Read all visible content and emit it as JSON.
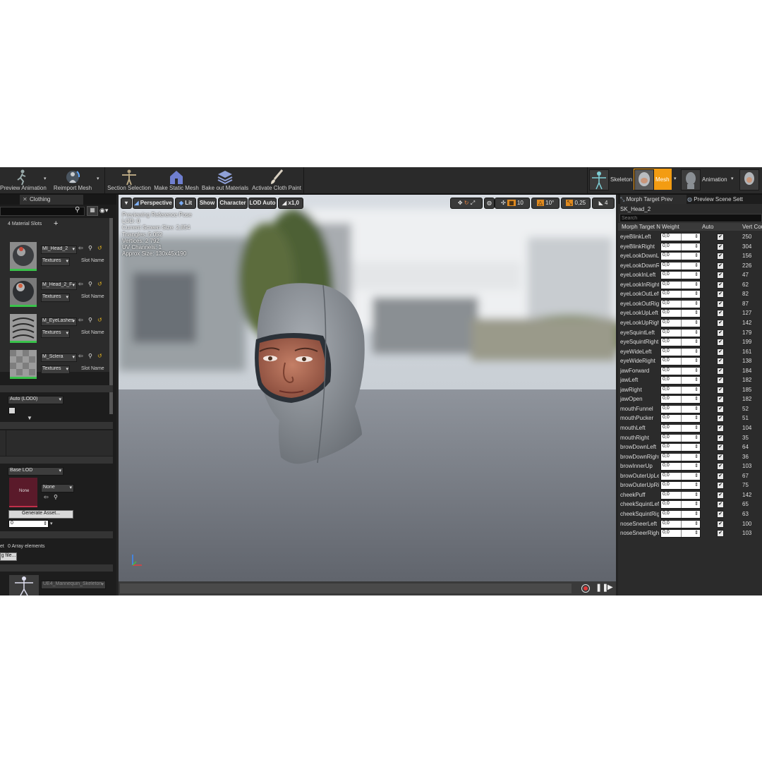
{
  "toolbar": {
    "left_buttons": [
      {
        "label": "Preview Animation",
        "icon": "running-mannequin-icon"
      },
      {
        "label": "Reimport Mesh",
        "icon": "reimport-icon"
      },
      {
        "label": "Section Selection",
        "icon": "t-pose-mannequin-icon"
      },
      {
        "label": "Make Static Mesh",
        "icon": "house-icon"
      },
      {
        "label": "Bake out Materials",
        "icon": "stack-layers-icon"
      },
      {
        "label": "Activate Cloth Paint",
        "icon": "paint-brush-icon"
      }
    ],
    "modes": [
      {
        "label": "Skeleton",
        "icon": "skeleton-mode-icon",
        "active": false
      },
      {
        "label": "Mesh",
        "icon": "mesh-mode-icon",
        "active": true
      },
      {
        "label": "Animation",
        "icon": "animation-mode-icon",
        "active": false
      }
    ],
    "active_color": "#f39c12"
  },
  "left_panel": {
    "tab": "Clothing",
    "material_slots_label": "4 Material Slots",
    "materials": [
      {
        "name": "MI_Head_2",
        "textures": "Textures",
        "slot_label": "Slot Name",
        "thumb": "head-material-thumbnail"
      },
      {
        "name": "M_Head_2_F",
        "textures": "Textures",
        "slot_label": "Slot Name",
        "thumb": "face-material-thumbnail"
      },
      {
        "name": "M_EyeLashes",
        "textures": "Textures",
        "slot_label": "Slot Name",
        "thumb": "eyelashes-material-thumbnail"
      },
      {
        "name": "M_Sclera",
        "textures": "Textures",
        "slot_label": "Slot Name",
        "thumb": "sclera-material-thumbnail"
      }
    ],
    "lod_combo": "Auto (LOD0)",
    "base_lod_combo": "Base LOD",
    "none_thumb": "None",
    "none_combo": "None",
    "generate_asset": "Generate Asset...",
    "numeric_value": "0",
    "array_label": "et",
    "array_elements": "0 Array elements",
    "file_button": "g file...",
    "skeleton_combo": "UE4_Mannequin_Skeleton"
  },
  "viewport": {
    "buttons": {
      "menu": "▾",
      "perspective": "Perspective",
      "lit": "Lit",
      "show": "Show",
      "character": "Character",
      "lod": "LOD Auto",
      "speed": "x1,0",
      "grid_snap": "10",
      "rot_snap": "10°",
      "scale_snap": "0,25",
      "camera_speed": "4"
    },
    "info_lines": [
      "Previewing Reference Pose",
      "LOD: 0",
      "Current Screen Size: 2,854",
      "Triangles: 5 052",
      "Vertices: 2 792",
      "UV Channels: 1",
      "Approx Size: 130x45x190"
    ]
  },
  "right_panel": {
    "tabs": [
      "Morph Target Prev",
      "Preview Scene Sett"
    ],
    "asset_name": "SK_Head_2",
    "search_placeholder": "Search",
    "columns": {
      "name": "Morph Target N",
      "weight": "Weight",
      "auto": "Auto",
      "vert": "Vert Cou"
    },
    "morph_targets": [
      {
        "name": "eyeBlinkLeft",
        "weight": "0,0",
        "auto": true,
        "verts": "250"
      },
      {
        "name": "eyeBlinkRight",
        "weight": "0,0",
        "auto": true,
        "verts": "304"
      },
      {
        "name": "eyeLookDownLeft",
        "weight": "0,0",
        "auto": true,
        "verts": "156"
      },
      {
        "name": "eyeLookDownRight",
        "weight": "0,0",
        "auto": true,
        "verts": "226"
      },
      {
        "name": "eyeLookInLeft",
        "weight": "0,0",
        "auto": true,
        "verts": "47"
      },
      {
        "name": "eyeLookInRight",
        "weight": "0,0",
        "auto": true,
        "verts": "62"
      },
      {
        "name": "eyeLookOutLeft",
        "weight": "0,0",
        "auto": true,
        "verts": "82"
      },
      {
        "name": "eyeLookOutRight",
        "weight": "0,0",
        "auto": true,
        "verts": "87"
      },
      {
        "name": "eyeLookUpLeft",
        "weight": "0,0",
        "auto": true,
        "verts": "127"
      },
      {
        "name": "eyeLookUpRight",
        "weight": "0,0",
        "auto": true,
        "verts": "142"
      },
      {
        "name": "eyeSquintLeft",
        "weight": "0,0",
        "auto": true,
        "verts": "179"
      },
      {
        "name": "eyeSquintRight",
        "weight": "0,0",
        "auto": true,
        "verts": "199"
      },
      {
        "name": "eyeWideLeft",
        "weight": "0,0",
        "auto": true,
        "verts": "161"
      },
      {
        "name": "eyeWideRight",
        "weight": "0,0",
        "auto": true,
        "verts": "138"
      },
      {
        "name": "jawForward",
        "weight": "0,0",
        "auto": true,
        "verts": "184"
      },
      {
        "name": "jawLeft",
        "weight": "0,0",
        "auto": true,
        "verts": "182"
      },
      {
        "name": "jawRight",
        "weight": "0,0",
        "auto": true,
        "verts": "185"
      },
      {
        "name": "jawOpen",
        "weight": "0,0",
        "auto": true,
        "verts": "182"
      },
      {
        "name": "mouthFunnel",
        "weight": "0,0",
        "auto": true,
        "verts": "52"
      },
      {
        "name": "mouthPucker",
        "weight": "0,0",
        "auto": true,
        "verts": "51"
      },
      {
        "name": "mouthLeft",
        "weight": "0,0",
        "auto": true,
        "verts": "104"
      },
      {
        "name": "mouthRight",
        "weight": "0,0",
        "auto": true,
        "verts": "35"
      },
      {
        "name": "browDownLeft",
        "weight": "0,0",
        "auto": true,
        "verts": "64"
      },
      {
        "name": "browDownRight",
        "weight": "0,0",
        "auto": true,
        "verts": "36"
      },
      {
        "name": "browInnerUp",
        "weight": "0,0",
        "auto": true,
        "verts": "103"
      },
      {
        "name": "browOuterUpLeft",
        "weight": "0,0",
        "auto": true,
        "verts": "67"
      },
      {
        "name": "browOuterUpRight",
        "weight": "0,0",
        "auto": true,
        "verts": "75"
      },
      {
        "name": "cheekPuff",
        "weight": "0,0",
        "auto": true,
        "verts": "142"
      },
      {
        "name": "cheekSquintLeft",
        "weight": "0,0",
        "auto": true,
        "verts": "65"
      },
      {
        "name": "cheekSquintRight",
        "weight": "0,0",
        "auto": true,
        "verts": "63"
      },
      {
        "name": "noseSneerLeft",
        "weight": "0,0",
        "auto": true,
        "verts": "100"
      },
      {
        "name": "noseSneerRight",
        "weight": "0,0",
        "auto": true,
        "verts": "103"
      }
    ]
  }
}
